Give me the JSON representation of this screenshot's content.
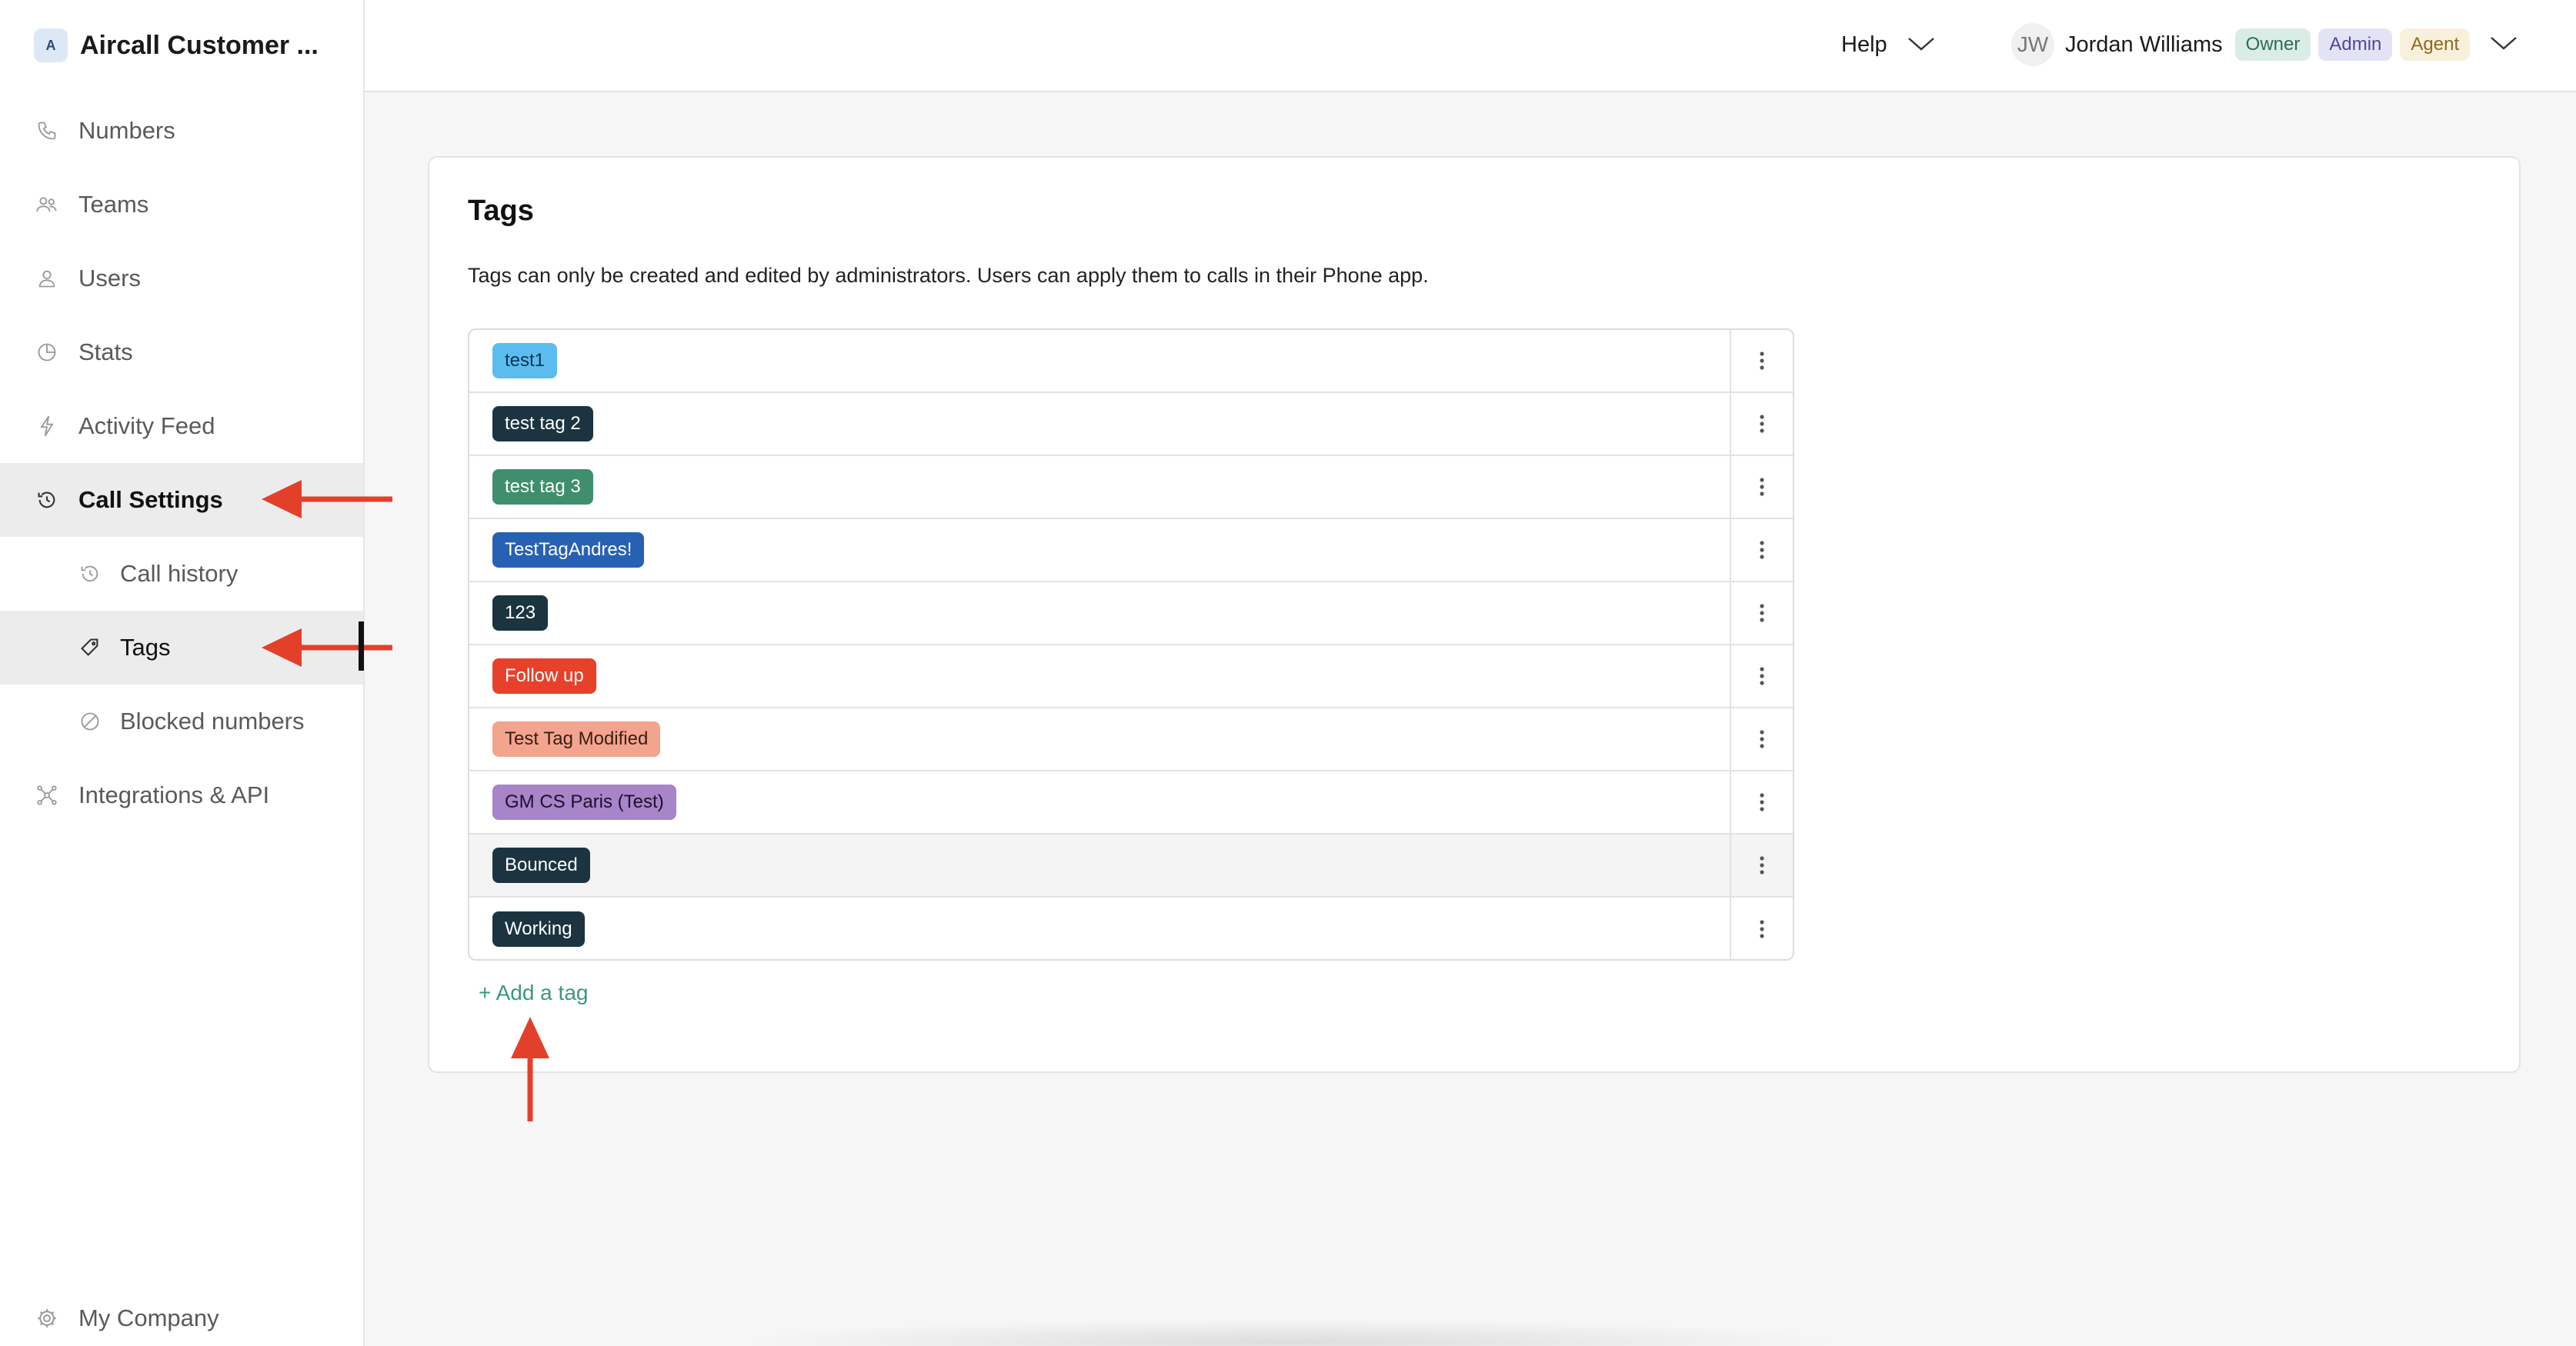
{
  "workspace": {
    "initial": "A",
    "name": "Aircall Customer ..."
  },
  "sidebar": {
    "items": [
      {
        "key": "numbers",
        "label": "Numbers",
        "icon": "phone-icon"
      },
      {
        "key": "teams",
        "label": "Teams",
        "icon": "team-icon"
      },
      {
        "key": "users",
        "label": "Users",
        "icon": "user-icon"
      },
      {
        "key": "stats",
        "label": "Stats",
        "icon": "pie-chart-icon"
      },
      {
        "key": "activity",
        "label": "Activity Feed",
        "icon": "bolt-icon"
      },
      {
        "key": "call-settings",
        "label": "Call Settings",
        "icon": "history-icon"
      },
      {
        "key": "call-history",
        "label": "Call history",
        "icon": "history-icon"
      },
      {
        "key": "tags",
        "label": "Tags",
        "icon": "tag-icon"
      },
      {
        "key": "blocked",
        "label": "Blocked numbers",
        "icon": "block-icon"
      },
      {
        "key": "integrations",
        "label": "Integrations & API",
        "icon": "integrations-icon"
      }
    ],
    "footer": {
      "label": "My Company",
      "icon": "gear-icon"
    }
  },
  "topbar": {
    "help_label": "Help",
    "user": {
      "initials": "JW",
      "name": "Jordan Williams",
      "roles": [
        "Owner",
        "Admin",
        "Agent"
      ]
    }
  },
  "tags_page": {
    "title": "Tags",
    "description": "Tags can only be created and edited by administrators. Users can apply them to calls in their Phone app.",
    "tags": [
      {
        "label": "test1",
        "color": "#5bbcef",
        "text_color": "#0d3550"
      },
      {
        "label": "test tag 2",
        "color": "#1c3440",
        "text_color": "#ffffff"
      },
      {
        "label": "test tag 3",
        "color": "#3f8f6d",
        "text_color": "#ffffff"
      },
      {
        "label": "TestTagAndres!",
        "color": "#2761b3",
        "text_color": "#ffffff"
      },
      {
        "label": "123",
        "color": "#1c3440",
        "text_color": "#ffffff"
      },
      {
        "label": "Follow up",
        "color": "#e7412a",
        "text_color": "#ffffff"
      },
      {
        "label": "Test Tag Modified",
        "color": "#f3a48e",
        "text_color": "#3a1d14"
      },
      {
        "label": "GM CS Paris (Test)",
        "color": "#a884c8",
        "text_color": "#1e0f2c"
      },
      {
        "label": "Bounced",
        "color": "#1c3440",
        "text_color": "#ffffff"
      },
      {
        "label": "Working",
        "color": "#1c3440",
        "text_color": "#ffffff"
      }
    ],
    "add_label": "+ Add a tag"
  },
  "annotation_color": "#e3402a"
}
